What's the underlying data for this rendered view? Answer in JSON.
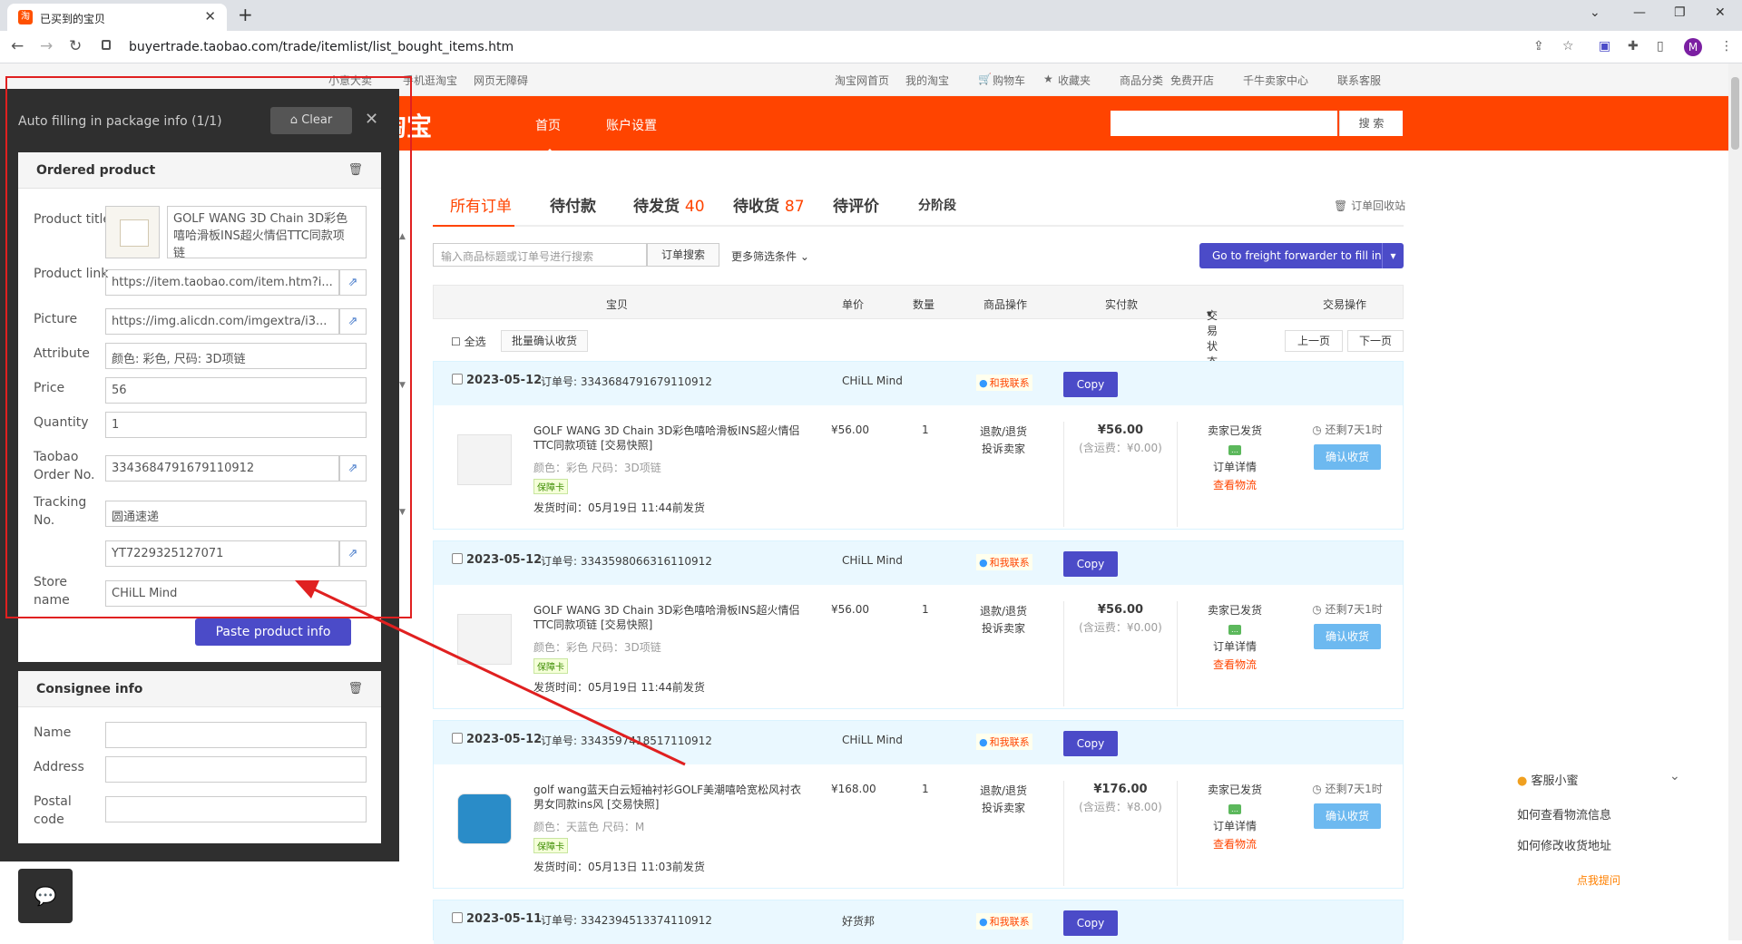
{
  "browser": {
    "tab_title": "已买到的宝贝",
    "favicon": "淘",
    "new_tab": "+",
    "url": "buyertrade.taobao.com/trade/itemlist/list_bought_items.htm",
    "avatar": "M"
  },
  "topnav": {
    "items": [
      "小意大卖",
      "手机逛淘宝",
      "网页无障碍",
      "淘宝网首页",
      "我的淘宝",
      "购物车",
      "收藏夹",
      "商品分类",
      "免费开店",
      "千牛卖家中心",
      "联系客服"
    ]
  },
  "header": {
    "logo": "淘宝",
    "nav_home": "首页",
    "nav_account": "账户设置",
    "search_button": "搜 索"
  },
  "order_tabs": {
    "all": "所有订单",
    "unpaid": "待付款",
    "to_ship": "待发货",
    "to_ship_count": "40",
    "to_receive": "待收货",
    "to_receive_count": "87",
    "to_review": "待评价",
    "installment": "分阶段",
    "recycle": "订单回收站"
  },
  "search": {
    "placeholder": "输入商品标题或订单号进行搜索",
    "button": "订单搜索",
    "more_filters": "更多筛选条件"
  },
  "freight_button": "Go to freight forwarder to fill in",
  "table_header": {
    "item": "宝贝",
    "unit_price": "单价",
    "quantity": "数量",
    "item_ops": "商品操作",
    "paid": "实付款",
    "status": "交易状态",
    "trade_ops": "交易操作"
  },
  "toolbar": {
    "select_all": "全选",
    "batch_confirm": "批量确认收货",
    "prev": "上一页",
    "next": "下一页"
  },
  "orders": [
    {
      "date": "2023-05-12",
      "order_no": "订单号: 3343684791679110912",
      "store": "CHiLL Mind",
      "contact": "和我联系",
      "copy": "Copy",
      "title": "GOLF WANG 3D Chain 3D彩色嘻哈滑板INS超火情侣TTC同款项链 [交易快照]",
      "attrs": "颜色：彩色  尺码：3D项链",
      "badge": "保障卡",
      "ship_time": "发货时间：05月19日 11:44前发货",
      "unit_price": "¥56.00",
      "qty": "1",
      "op1": "退款/退货",
      "op2": "投诉卖家",
      "paid": "¥56.00",
      "shipping": "(含运费：¥0.00)",
      "status1": "卖家已发货",
      "status2": "订单详情",
      "status3": "查看物流",
      "remaining": "还剩7天1时",
      "confirm": "确认收货"
    },
    {
      "date": "2023-05-12",
      "order_no": "订单号: 3343598066316110912",
      "store": "CHiLL Mind",
      "contact": "和我联系",
      "copy": "Copy",
      "title": "GOLF WANG 3D Chain 3D彩色嘻哈滑板INS超火情侣TTC同款项链 [交易快照]",
      "attrs": "颜色：彩色  尺码：3D项链",
      "badge": "保障卡",
      "ship_time": "发货时间：05月19日 11:44前发货",
      "unit_price": "¥56.00",
      "qty": "1",
      "op1": "退款/退货",
      "op2": "投诉卖家",
      "paid": "¥56.00",
      "shipping": "(含运费：¥0.00)",
      "status1": "卖家已发货",
      "status2": "订单详情",
      "status3": "查看物流",
      "remaining": "还剩7天1时",
      "confirm": "确认收货"
    },
    {
      "date": "2023-05-12",
      "order_no": "订单号: 3343597418517110912",
      "store": "CHiLL Mind",
      "contact": "和我联系",
      "copy": "Copy",
      "title": "golf wang蓝天白云短袖衬衫GOLF美潮嘻哈宽松风衬衣男女同款ins风 [交易快照]",
      "attrs": "颜色：天蓝色  尺码：M",
      "badge": "保障卡",
      "ship_time": "发货时间：05月13日 11:03前发货",
      "unit_price": "¥168.00",
      "qty": "1",
      "op1": "退款/退货",
      "op2": "投诉卖家",
      "paid": "¥176.00",
      "shipping": "(含运费：¥8.00)",
      "status1": "卖家已发货",
      "status2": "订单详情",
      "status3": "查看物流",
      "remaining": "还剩7天1时",
      "confirm": "确认收货"
    },
    {
      "date": "2023-05-11",
      "order_no": "订单号: 3342394513374110912",
      "store": "好货邦",
      "contact": "和我联系",
      "copy": "Copy"
    }
  ],
  "service": {
    "title": "客服小蜜",
    "q1": "如何查看物流信息",
    "q2": "如何修改收货地址",
    "ask": "点我提问"
  },
  "panel": {
    "header": "Auto filling in package info  (1/1)",
    "clear": "Clear",
    "ordered_product": "Ordered product",
    "fields": {
      "product_title_label": "Product title",
      "product_title": "GOLF WANG 3D Chain 3D彩色嘻哈滑板INS超火情侣TTC同款项链",
      "product_link_label": "Product link",
      "product_link": "https://item.taobao.com/item.htm?i...",
      "picture_label": "Picture",
      "picture": "https://img.alicdn.com/imgextra/i3...",
      "attribute_label": "Attribute",
      "attribute": "颜色: 彩色, 尺码: 3D项链",
      "price_label": "Price",
      "price": "56",
      "quantity_label": "Quantity",
      "quantity": "1",
      "order_no_label": "Taobao Order No.",
      "order_no": "3343684791679110912",
      "tracking_label": "Tracking No.",
      "carrier": "圆通速递",
      "tracking_no": "YT7229325127071",
      "store_label": "Store name",
      "store": "CHiLL Mind"
    },
    "paste_button": "Paste product info",
    "consignee_info": "Consignee info",
    "consignee": {
      "name_label": "Name",
      "address_label": "Address",
      "postal_label": "Postal code"
    }
  },
  "colors": {
    "taobao_orange": "#ff4400",
    "button_purple": "#4b4bc8",
    "annotation_red": "#e02020"
  }
}
